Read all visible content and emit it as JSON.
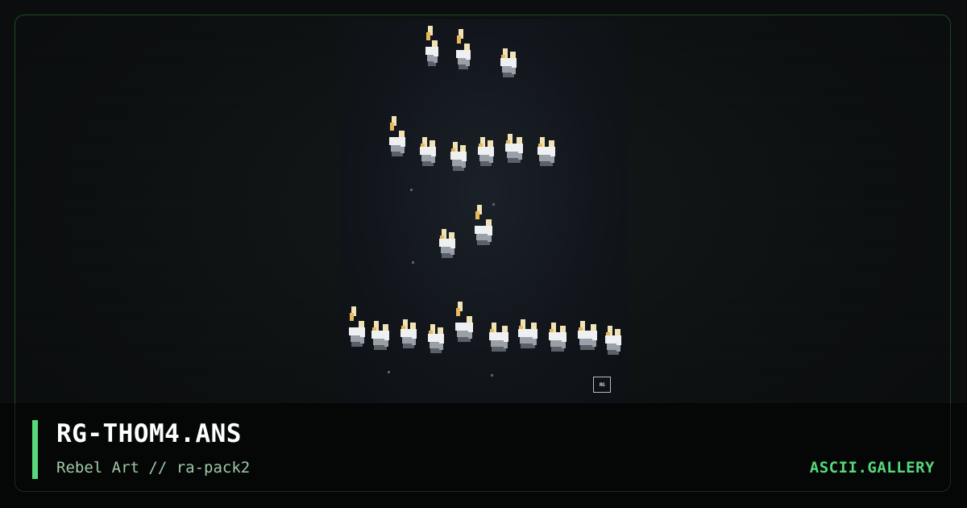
{
  "card": {
    "title": "RG-THOM4.ANS",
    "subtitle": "Rebel Art // ra-pack2",
    "brand": "ASCII.GALLERY"
  },
  "artwork": {
    "badge_text": "RG",
    "palette": {
      "cream": "#f1e3b6",
      "gold": "#e7b95a",
      "white": "#eef0f2",
      "grey": "#9aa0a8",
      "dark_grey": "#5a6068",
      "background": "#12161c"
    }
  },
  "theme": {
    "accent": "#57d87a",
    "frame_border": "#1f4a26",
    "subtitle_color": "#9fc9a6"
  }
}
